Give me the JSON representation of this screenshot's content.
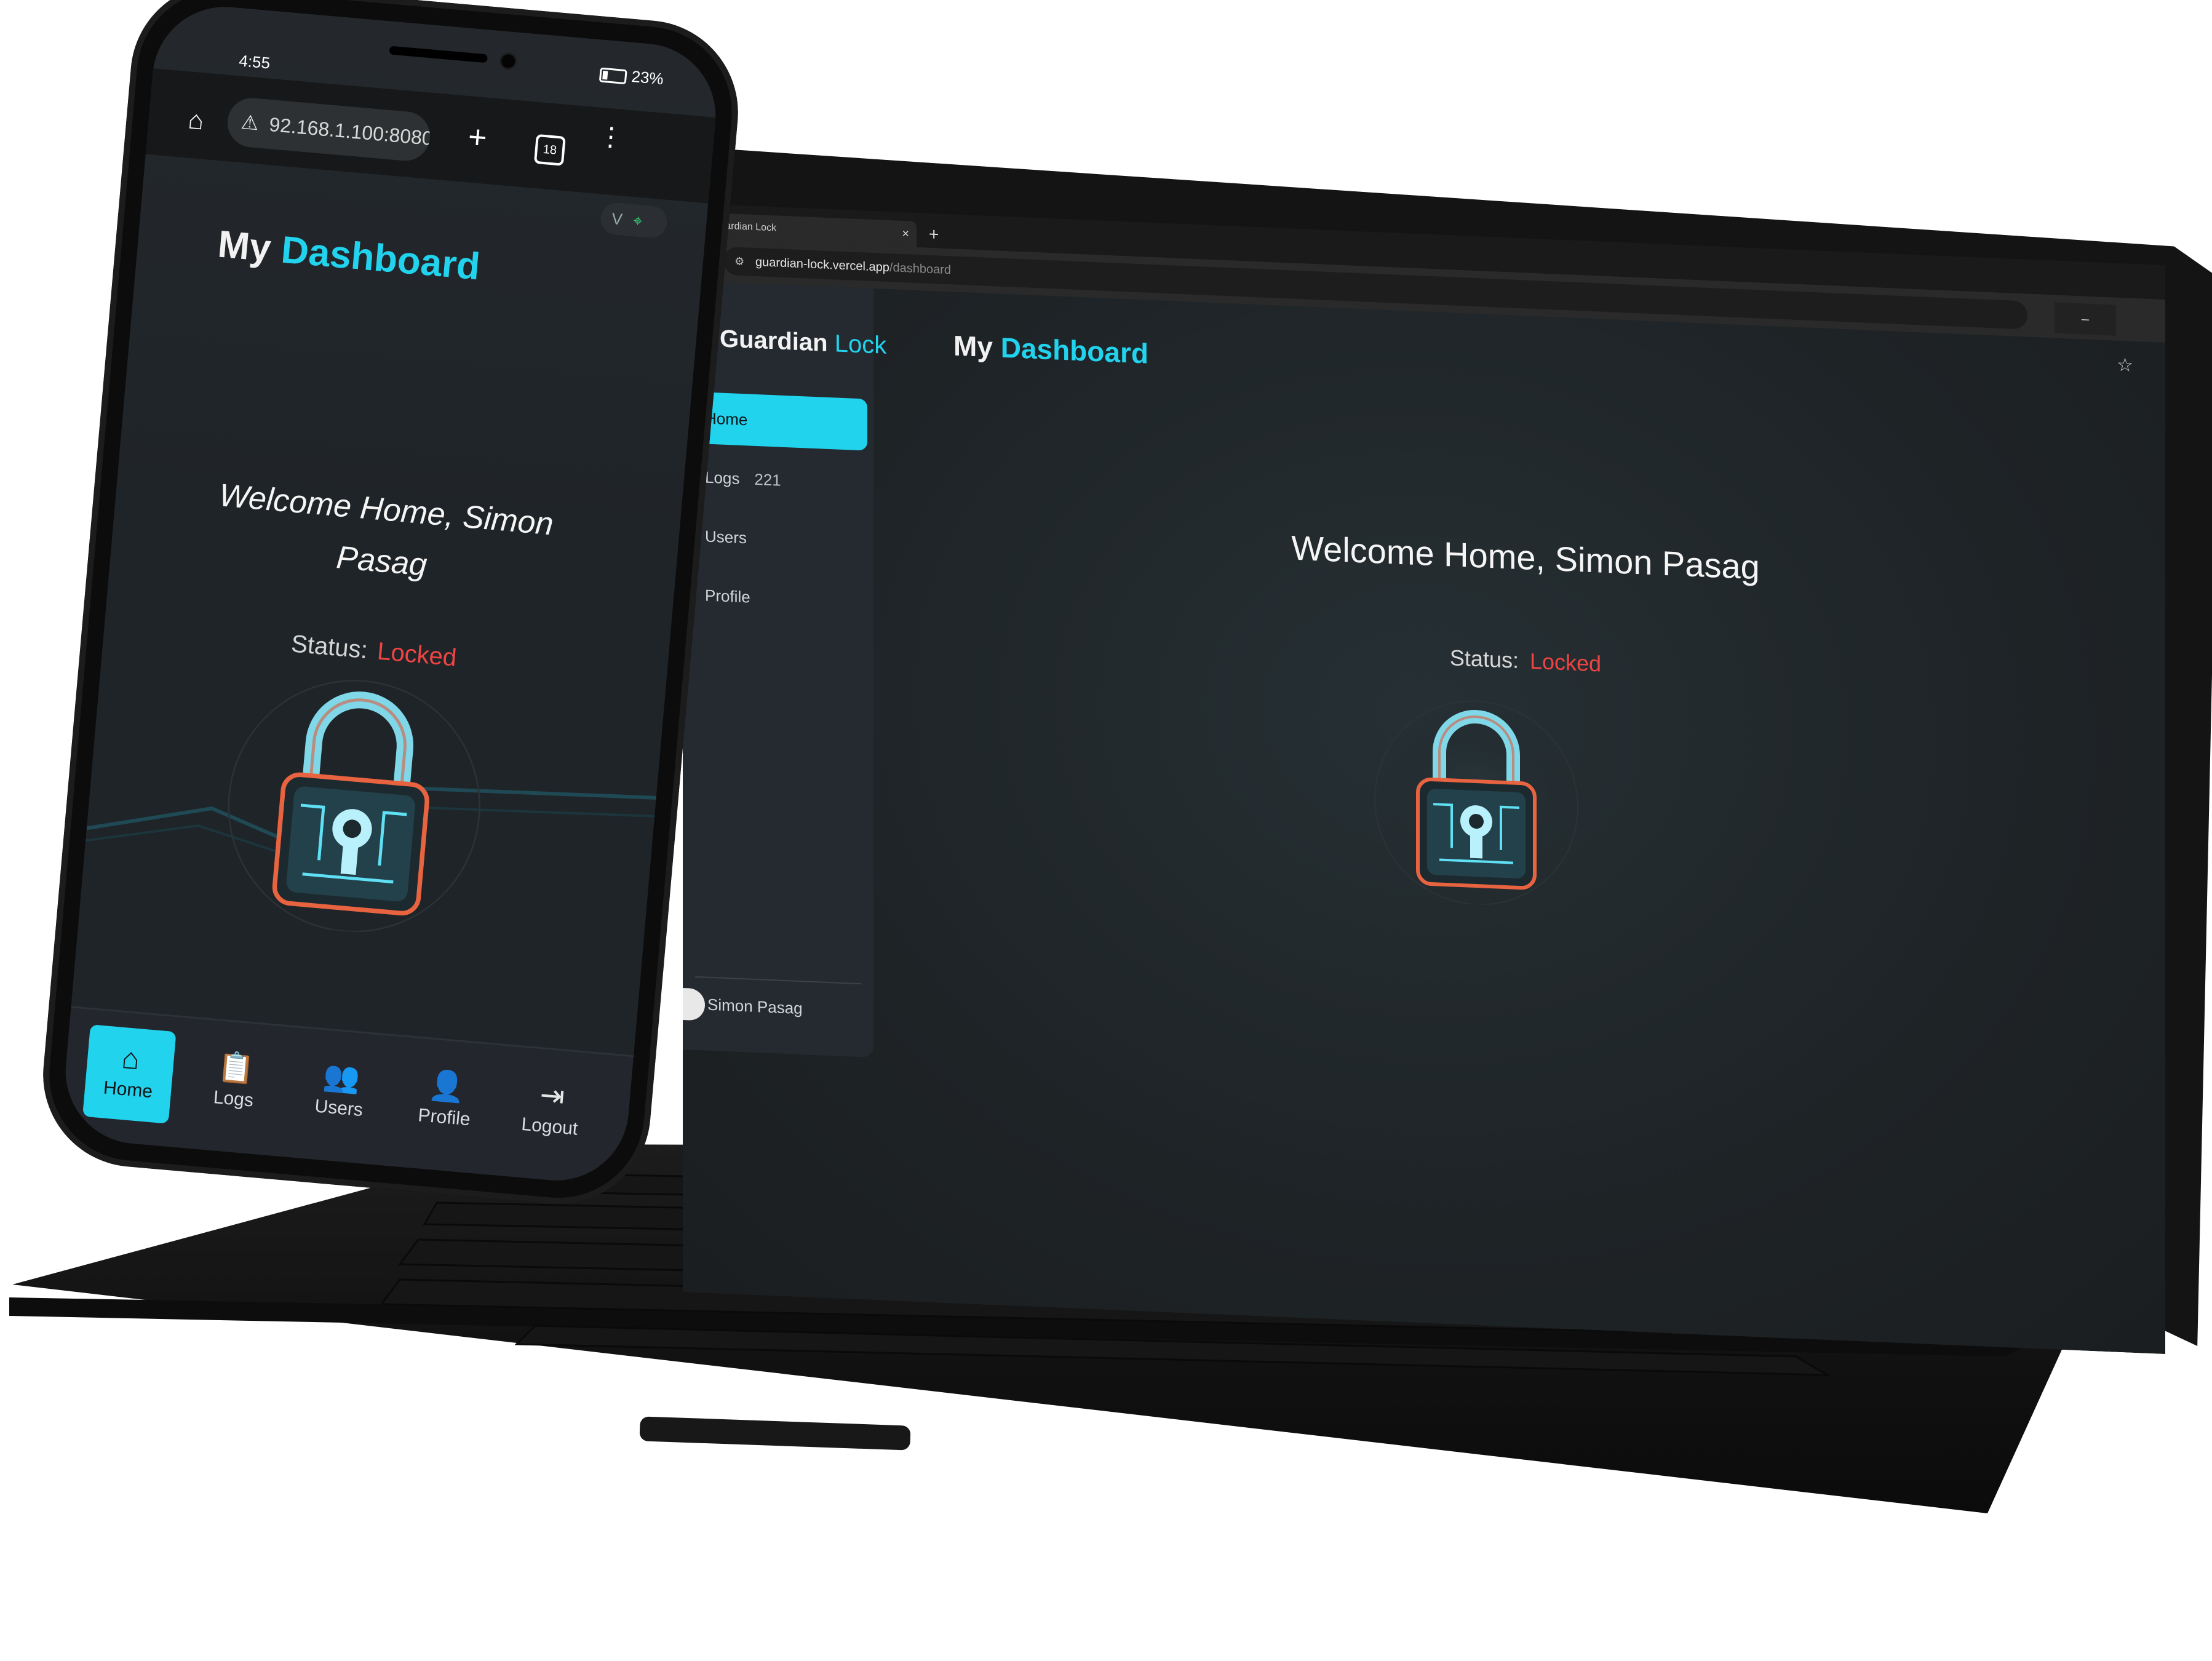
{
  "laptop": {
    "tab_title": "Guardian Lock",
    "tab_close": "×",
    "tab_new": "+",
    "reload_icon": "⟳",
    "url_host": "guardian-lock.vercel.app",
    "url_path": "/dashboard",
    "win_min": "–",
    "star_icon": "☆",
    "brand_main": "Guardian",
    "brand_accent": "Lock",
    "nav": [
      {
        "label": "Home",
        "badge": ""
      },
      {
        "label": "Logs",
        "badge": "221"
      },
      {
        "label": "Users",
        "badge": ""
      },
      {
        "label": "Profile",
        "badge": ""
      }
    ],
    "user_name": "Simon Pasag",
    "title_main": "My",
    "title_accent": "Dashboard",
    "welcome": "Welcome Home, Simon Pasag",
    "status_label": "Status:",
    "status_value": "Locked"
  },
  "phone": {
    "time": "4:55",
    "battery": "23%",
    "url": "92.168.1.100:8080",
    "tabs_count": "18",
    "plus": "+",
    "menu": "⋮",
    "ext_label": "V",
    "title_main": "My",
    "title_accent": "Dashboard",
    "welcome": "Welcome Home, Simon Pasag",
    "status_label": "Status:",
    "status_value": "Locked",
    "bottom_nav": [
      {
        "label": "Home",
        "icon": "home-icon"
      },
      {
        "label": "Logs",
        "icon": "clipboard-icon"
      },
      {
        "label": "Users",
        "icon": "users-icon"
      },
      {
        "label": "Profile",
        "icon": "user-icon"
      },
      {
        "label": "Logout",
        "icon": "logout-icon"
      }
    ]
  },
  "colors": {
    "accent": "#22d3ee",
    "locked": "#ef4444",
    "background": "#1f2428"
  }
}
